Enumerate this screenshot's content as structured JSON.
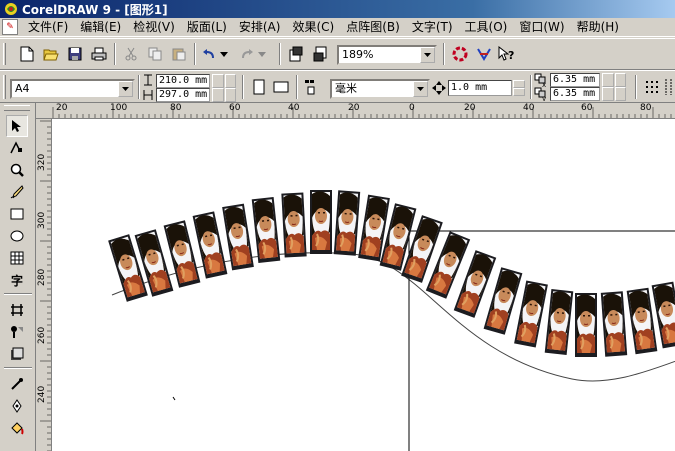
{
  "app": {
    "title": "CorelDRAW 9 - [图形1]"
  },
  "menu": {
    "items": [
      "文件(F)",
      "编辑(E)",
      "检视(V)",
      "版面(L)",
      "安排(A)",
      "效果(C)",
      "点阵图(B)",
      "文字(T)",
      "工具(O)",
      "窗口(W)",
      "帮助(H)"
    ]
  },
  "toolbar": {
    "zoom": "189%"
  },
  "property_bar": {
    "page_size": "A4",
    "width": "210.0 mm",
    "height": "297.0 mm",
    "units": "毫米",
    "nudge": "1.0 mm",
    "dup_x": "6.35 mm",
    "dup_y": "6.35 mm"
  },
  "ruler": {
    "h_labels": [
      "20",
      "100",
      "80",
      "60",
      "40",
      "20",
      "0",
      "20",
      "40",
      "60",
      "80"
    ],
    "v_labels": [
      "320",
      "300",
      "280",
      "260",
      "240"
    ]
  },
  "colors": {
    "titlebar": "#0a246a",
    "canvas": "#ffffff",
    "chrome": "#d4d0c8"
  }
}
